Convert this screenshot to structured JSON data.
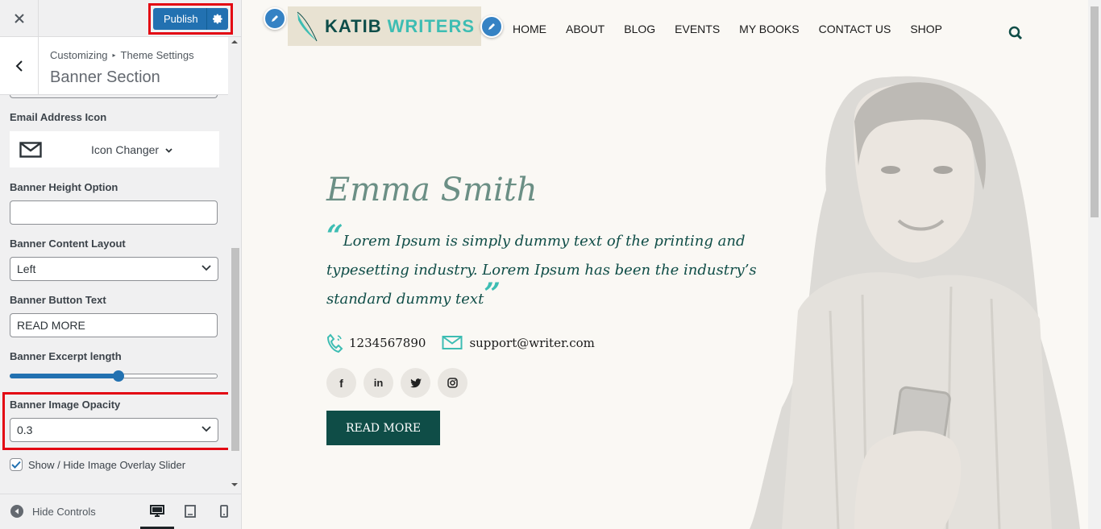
{
  "customizer": {
    "publish_label": "Publish",
    "breadcrumb_root": "Customizing",
    "breadcrumb_current": "Theme Settings",
    "section_title": "Banner Section",
    "email_icon_label": "Email Address Icon",
    "icon_changer_label": "Icon Changer",
    "banner_height_label": "Banner Height Option",
    "banner_height_value": "",
    "content_layout_label": "Banner Content Layout",
    "content_layout_value": "Left",
    "button_text_label": "Banner Button Text",
    "button_text_value": "READ MORE",
    "excerpt_length_label": "Banner Excerpt length",
    "excerpt_length_fraction": 0.52,
    "image_opacity_label": "Banner Image Opacity",
    "image_opacity_value": "0.3",
    "overlay_checkbox_label": "Show / Hide Image Overlay Slider",
    "overlay_checked": true,
    "hide_controls_label": "Hide Controls",
    "devices": [
      "desktop-icon",
      "tablet-icon",
      "mobile-icon"
    ]
  },
  "site": {
    "logo_word1": "KATIB",
    "logo_word2": "WRITERS",
    "nav": [
      "HOME",
      "ABOUT",
      "BLOG",
      "EVENTS",
      "MY BOOKS",
      "CONTACT US",
      "SHOP"
    ],
    "hero_name": "Emma Smith",
    "hero_quote": "Lorem Ipsum is simply dummy text of the printing and typesetting industry. Lorem Ipsum has been the industry’s standard dummy text",
    "phone": "1234567890",
    "email": "support@writer.com",
    "social": [
      "facebook-icon",
      "linkedin-icon",
      "twitter-icon",
      "instagram-icon"
    ],
    "button_label": "READ MORE"
  },
  "colors": {
    "accent": "#2271b1",
    "highlight": "#e30613",
    "site_primary": "#0f4d47",
    "site_accent": "#3dbdb3"
  }
}
